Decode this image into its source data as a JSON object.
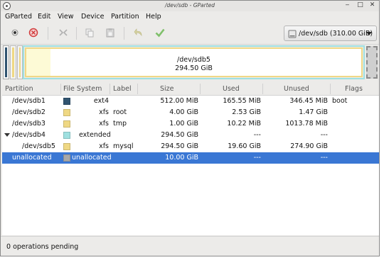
{
  "window": {
    "title": "/dev/sdb - GParted"
  },
  "menu": [
    "GParted",
    "Edit",
    "View",
    "Device",
    "Partition",
    "Help"
  ],
  "toolbar": {
    "buttons": [
      "new-partition",
      "delete-partition",
      "resize-move",
      "copy",
      "paste",
      "undo",
      "apply"
    ],
    "device_selector": "/dev/sdb (310.00 GiB)"
  },
  "visual": {
    "sdb5_label": "/dev/sdb5",
    "sdb5_size": "294.50 GiB"
  },
  "columns": [
    "Partition",
    "File System",
    "Label",
    "Size",
    "Used",
    "Unused",
    "Flags"
  ],
  "rows": [
    {
      "partition": "/dev/sdb1",
      "filesystem": "ext4",
      "label": "",
      "size": "512.00 MiB",
      "used": "165.55 MiB",
      "unused": "346.45 MiB",
      "flags": "boot",
      "color": "#315470"
    },
    {
      "partition": "/dev/sdb2",
      "filesystem": "xfs",
      "label": "root",
      "size": "4.00 GiB",
      "used": "2.53 GiB",
      "unused": "1.47 GiB",
      "flags": "",
      "color": "#efd884"
    },
    {
      "partition": "/dev/sdb3",
      "filesystem": "xfs",
      "label": "tmp",
      "size": "1.00 GiB",
      "used": "10.22 MiB",
      "unused": "1013.78 MiB",
      "flags": "",
      "color": "#efd884"
    },
    {
      "partition": "/dev/sdb4",
      "filesystem": "extended",
      "label": "",
      "size": "294.50 GiB",
      "used": "---",
      "unused": "---",
      "flags": "",
      "color": "#9fe0e0"
    },
    {
      "partition": "/dev/sdb5",
      "filesystem": "xfs",
      "label": "mysql",
      "size": "294.50 GiB",
      "used": "19.60 GiB",
      "unused": "274.90 GiB",
      "flags": "",
      "color": "#efd884"
    },
    {
      "partition": "unallocated",
      "filesystem": "unallocated",
      "label": "",
      "size": "10.00 GiB",
      "used": "---",
      "unused": "---",
      "flags": "",
      "color": "#a8a8a8"
    }
  ],
  "status": "0 operations pending"
}
